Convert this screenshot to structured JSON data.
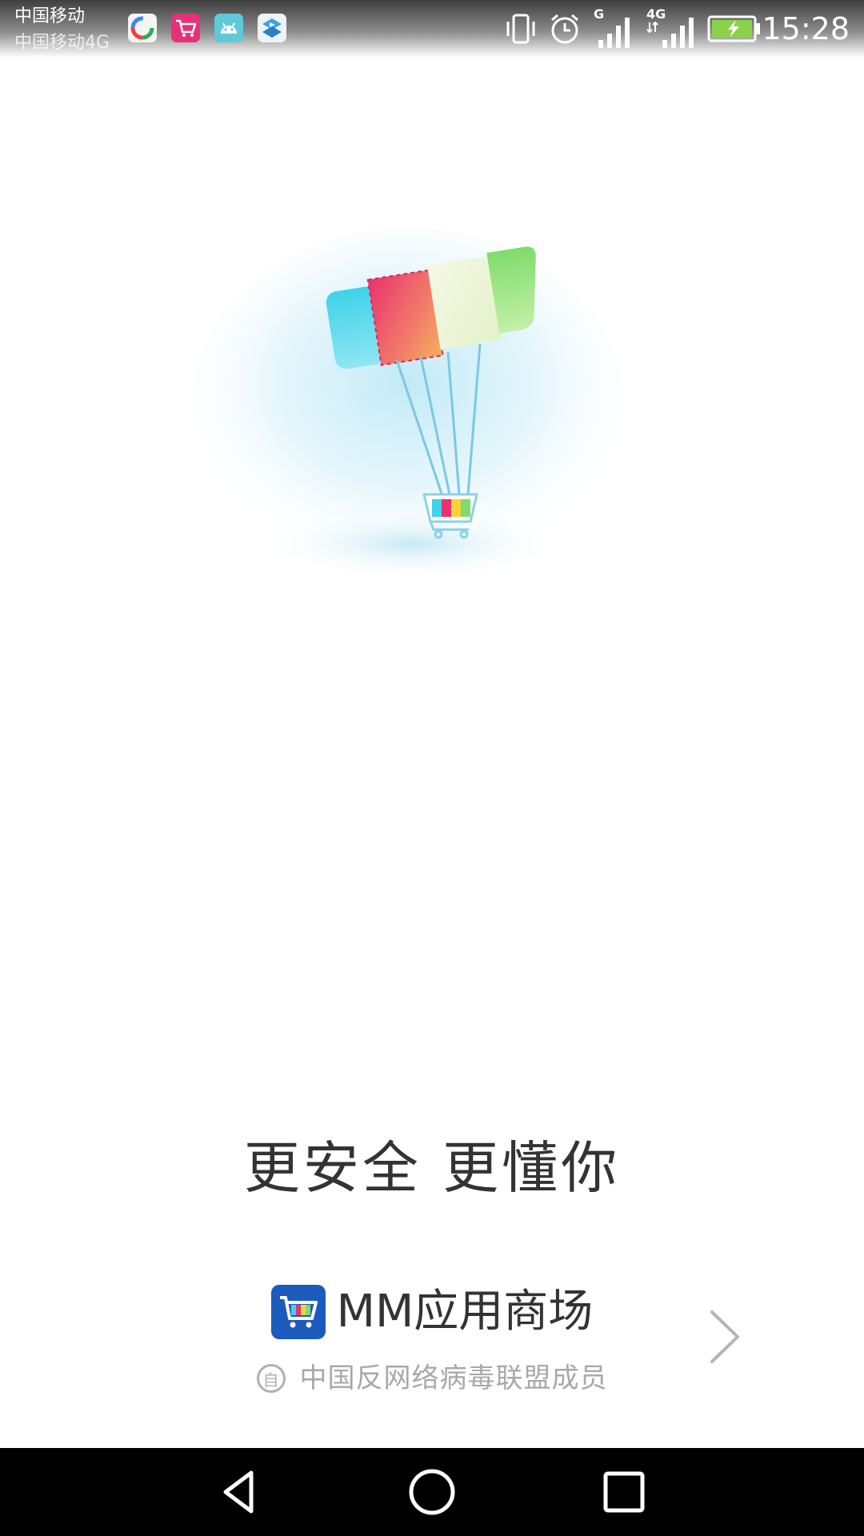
{
  "status_bar": {
    "carrier_1": "中国移动",
    "carrier_2": "中国移动4G",
    "network_1": "G",
    "network_2": "4G",
    "time": "15:28",
    "notification_icons": [
      "browser-app-icon",
      "shopping-cart-app-icon",
      "android-app-icon",
      "video-app-icon"
    ],
    "status_icons": [
      "vibrate-icon",
      "alarm-icon",
      "signal-icon",
      "signal-4g-icon",
      "battery-charging-icon"
    ]
  },
  "splash": {
    "illustration": "parachute-shopping-cart-illustration",
    "slogan": "更安全 更懂你",
    "brand_name": "MM应用商场",
    "brand_logo": "shopping-cart-logo-icon",
    "member_badge": "自",
    "member_text": "中国反网络病毒联盟成员",
    "next_icon": "chevron-right-icon"
  },
  "nav_bar": {
    "buttons": [
      "back-icon",
      "home-icon",
      "recent-apps-icon"
    ]
  },
  "colors": {
    "brand_blue": "#1c5bbd",
    "text_dark": "#333333",
    "text_gray": "#a8a8a8",
    "cyan": "#3fd2e8",
    "pink": "#e8326e",
    "yellow": "#f5d43a",
    "green": "#8be07a"
  }
}
